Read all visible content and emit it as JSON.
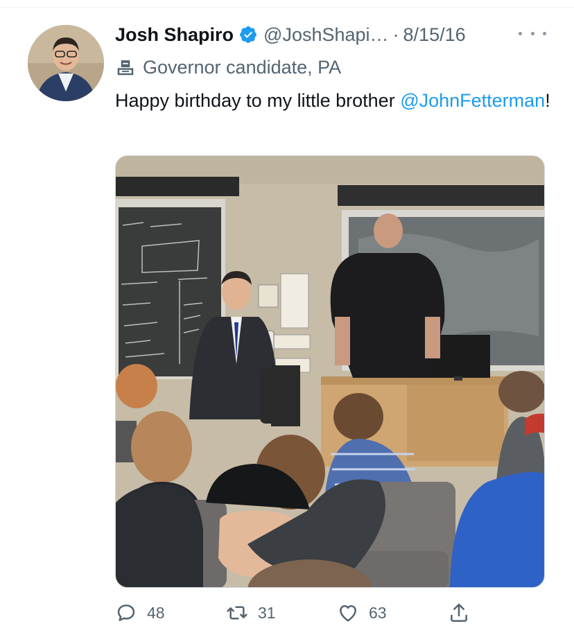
{
  "tweet": {
    "author_name": "Josh Shapiro",
    "handle": "@JoshShapi…",
    "separator": "·",
    "date": "8/15/16",
    "label": "Governor candidate, PA",
    "text_before": "Happy birthday to my little brother ",
    "mention": "@JohnFetterman",
    "text_after": "!"
  },
  "actions": {
    "replies": "48",
    "retweets": "31",
    "likes": "63"
  },
  "icons": {
    "verified": "verified-badge-icon",
    "label": "ballot-box-icon",
    "more": "more-options-icon",
    "reply": "reply-icon",
    "retweet": "retweet-icon",
    "like": "heart-icon",
    "share": "share-icon"
  },
  "colors": {
    "accent": "#1d9bf0",
    "secondary_text": "#536471",
    "primary_text": "#0f1419"
  }
}
